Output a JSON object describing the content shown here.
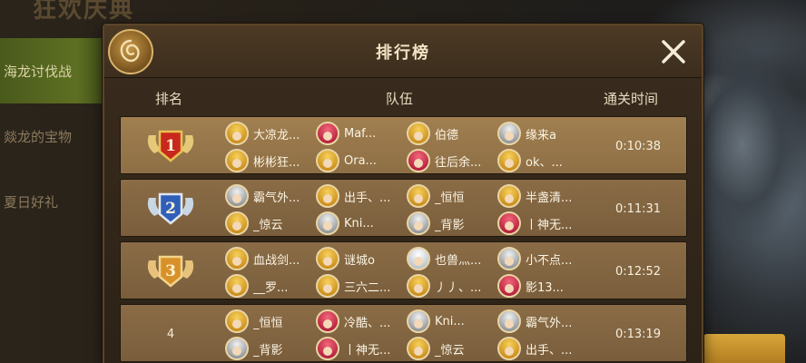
{
  "event_title": "狂欢庆典",
  "side_menu": [
    {
      "label": "海龙讨伐战",
      "active": true
    },
    {
      "label": "燚龙的宝物",
      "active": false
    },
    {
      "label": "夏日好礼",
      "active": false
    }
  ],
  "panel": {
    "title": "排行榜",
    "close_icon": "close-icon",
    "headers": {
      "rank": "排名",
      "team": "队伍",
      "time": "通关时间"
    }
  },
  "rows": [
    {
      "rank": "1",
      "medal": "gold-medal-icon",
      "time": "0:10:38",
      "members": [
        {
          "name": "大凉龙...",
          "avatar": "gold"
        },
        {
          "name": "Maf...",
          "avatar": "red"
        },
        {
          "name": "伯德",
          "avatar": "gold"
        },
        {
          "name": "缘来a",
          "avatar": "silver"
        },
        {
          "name": "彬彬狂...",
          "avatar": "gold"
        },
        {
          "name": "Ora...",
          "avatar": "gold"
        },
        {
          "name": "往后余...",
          "avatar": "red"
        },
        {
          "name": "ok、...",
          "avatar": "gold"
        }
      ]
    },
    {
      "rank": "2",
      "medal": "silver-medal-icon",
      "time": "0:11:31",
      "members": [
        {
          "name": "霸气外...",
          "avatar": "silver"
        },
        {
          "name": "出手、...",
          "avatar": "gold"
        },
        {
          "name": "_恒恒",
          "avatar": "gold"
        },
        {
          "name": "半盏清...",
          "avatar": "gold"
        },
        {
          "name": "_惊云",
          "avatar": "gold"
        },
        {
          "name": "Kni...",
          "avatar": "silver"
        },
        {
          "name": "_背影",
          "avatar": "silver"
        },
        {
          "name": "丨神无...",
          "avatar": "red"
        }
      ]
    },
    {
      "rank": "3",
      "medal": "bronze-medal-icon",
      "time": "0:12:52",
      "members": [
        {
          "name": "血战剑...",
          "avatar": "gold"
        },
        {
          "name": "谜城o",
          "avatar": "gold"
        },
        {
          "name": "也兽灬...",
          "avatar": "white"
        },
        {
          "name": "小不点...",
          "avatar": "silver"
        },
        {
          "name": "__罗...",
          "avatar": "gold"
        },
        {
          "name": "三六二...",
          "avatar": "gold"
        },
        {
          "name": "丿丿、...",
          "avatar": "gold"
        },
        {
          "name": "影13...",
          "avatar": "red"
        }
      ]
    },
    {
      "rank": "4",
      "medal": "",
      "time": "0:13:19",
      "members": [
        {
          "name": "_恒恒",
          "avatar": "gold"
        },
        {
          "name": "冷酷、...",
          "avatar": "red"
        },
        {
          "name": "Kni...",
          "avatar": "silver"
        },
        {
          "name": "霸气外...",
          "avatar": "silver"
        },
        {
          "name": "_背影",
          "avatar": "silver"
        },
        {
          "name": "丨神无...",
          "avatar": "red"
        },
        {
          "name": "_惊云",
          "avatar": "gold"
        },
        {
          "name": "出手、...",
          "avatar": "gold"
        }
      ]
    }
  ]
}
